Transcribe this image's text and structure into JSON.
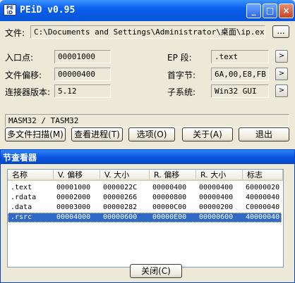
{
  "window": {
    "title": "PEiD v0.95",
    "icon_text": "PE iD",
    "controls": {
      "minimize": "_",
      "maximize": "□",
      "close": "×"
    }
  },
  "file": {
    "label": "文件:",
    "path": "C:\\Documents and Settings\\Administrator\\桌面\\ip.exe",
    "browse_label": "..."
  },
  "fields": {
    "entry_point": {
      "label": "入口点:",
      "value": "00001000"
    },
    "file_offset": {
      "label": "文件偏移:",
      "value": "00000400"
    },
    "linker_version": {
      "label": "连接器版本:",
      "value": "5.12"
    },
    "ep_section": {
      "label": "EP 段:",
      "value": ".text",
      "button": ">"
    },
    "first_bytes": {
      "label": "首字节:",
      "value": "6A,00,E8,FB",
      "button": ">"
    },
    "subsystem": {
      "label": "子系统:",
      "value": "Win32 GUI",
      "button": ">"
    }
  },
  "detection": {
    "result": "MASM32 / TASM32"
  },
  "buttons": {
    "multi_scan": "多文件扫描(M)",
    "view_process": "查看进程(T)",
    "options": "选项(O)",
    "about": "关于(A)",
    "exit": "退出"
  },
  "dialog": {
    "title": "节查看器",
    "columns": [
      "名称",
      "V. 偏移",
      "V. 大小",
      "R. 偏移",
      "R. 大小",
      "标志"
    ],
    "rows": [
      [
        ".text",
        "00001000",
        "0000022C",
        "00000400",
        "00000400",
        "60000020"
      ],
      [
        ".rdata",
        "00002000",
        "00000266",
        "00000800",
        "00000400",
        "40000040"
      ],
      [
        ".data",
        "00003000",
        "00000282",
        "00000C00",
        "00000200",
        "C0000040"
      ],
      [
        ".rsrc",
        "00004000",
        "00000600",
        "00000E00",
        "00000600",
        "40000040"
      ]
    ],
    "selected_row": 3,
    "close_button": "关闭(C)"
  }
}
